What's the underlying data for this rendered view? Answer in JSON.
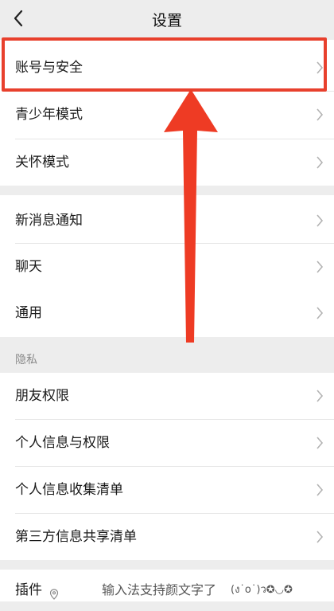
{
  "header": {
    "title": "设置",
    "back_icon": "chevron-left-icon"
  },
  "groups": {
    "account": {
      "items": [
        {
          "label": "账号与安全"
        },
        {
          "label": "青少年模式"
        },
        {
          "label": "关怀模式"
        }
      ]
    },
    "general": {
      "items": [
        {
          "label": "新消息通知"
        },
        {
          "label": "聊天"
        },
        {
          "label": "通用"
        }
      ]
    },
    "privacy": {
      "section_label": "隐私",
      "items": [
        {
          "label": "朋友权限"
        },
        {
          "label": "个人信息与权限"
        },
        {
          "label": "个人信息收集清单"
        },
        {
          "label": "第三方信息共享清单"
        }
      ]
    }
  },
  "plugin": {
    "label": "插件",
    "hint": "输入法支持颜文字了",
    "emoji": "(ง˙o˙)ว✪◡✪"
  },
  "colors": {
    "highlight": "#e8402d",
    "background": "#ededed",
    "row": "#ffffff"
  }
}
